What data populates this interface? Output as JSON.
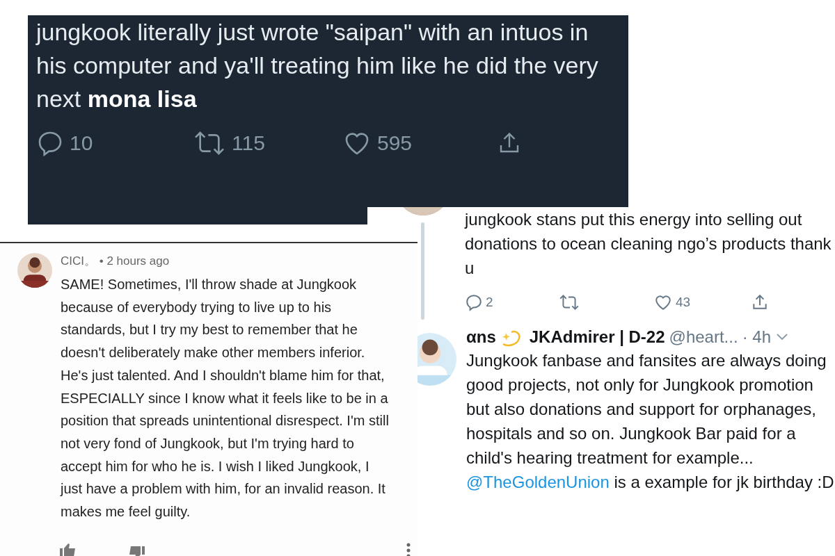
{
  "dark_tweet": {
    "text": "jungkook literally just wrote \"saipan\" with an intuos in his computer and ya'll treating him like he did the very next **mona lisa**",
    "replies": "10",
    "retweets": "115",
    "likes": "595"
  },
  "comment": {
    "author": "CICI。",
    "time": "• 2 hours ago",
    "text": "SAME! Sometimes, I'll throw shade at Jungkook because of everybody trying to live up to his standards, but I try my best to remember that he doesn't deliberately make other members inferior. He's just talented. And I shouldn't blame him for that, ESPECIALLY since I know what it feels like to be in a position that spreads unintentional disrespect. I'm still not very fond of Jungkook, but I'm trying hard to accept him for who he is. I wish I liked Jungkook, I just have a problem with him, for an invalid reason. It makes me feel guilty."
  },
  "reply_tweet": {
    "text": "jungkook stans put this energy into selling out donations to ocean cleaning ngo’s products thank u",
    "replies": "2",
    "likes": "43"
  },
  "tweet": {
    "display_name": "αns",
    "name": "JKAdmirer | D-22",
    "handle": "@heart...",
    "time": "· 4h",
    "text": "Jungkook fanbase and fansites are always doing good projects, not only for Jungkook promotion but also donations and support for orphanages, hospitals and so on. Jungkook Bar paid for a child's hearing treatment for example...",
    "link": "@TheGoldenUnion",
    "link_suffix": " is a example for jk birthday :D"
  }
}
